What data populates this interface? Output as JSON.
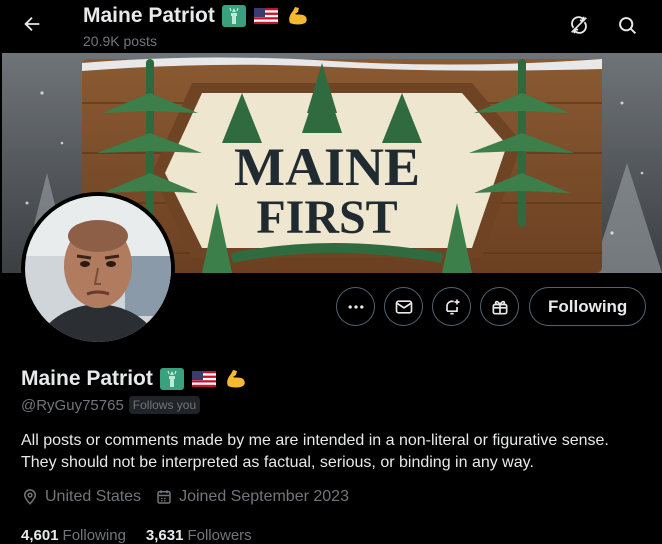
{
  "header": {
    "title": "Maine Patriot",
    "posts": "20.9K posts"
  },
  "banner": {
    "line1": "MAINE",
    "line2": "FIRST"
  },
  "actions": {
    "follow_label": "Following"
  },
  "profile": {
    "name": "Maine Patriot",
    "handle": "@RyGuy75765",
    "follows_you": "Follows you",
    "bio": "All posts or comments made by me are intended in a non-literal or figurative sense. They should not be interpreted as factual, serious, or binding in any way.",
    "location": "United States",
    "joined": "Joined September 2023",
    "following_count": "4,601",
    "following_label": "Following",
    "followers_count": "3,631",
    "followers_label": "Followers"
  },
  "colors": {
    "background": "#000000",
    "text_primary": "#e7e9ea",
    "text_secondary": "#71767b",
    "border": "#536471"
  },
  "icons": [
    "back-arrow-icon",
    "retweet-cycle-icon",
    "search-icon",
    "more-icon",
    "mail-icon",
    "notify-plus-icon",
    "gift-icon",
    "location-pin-icon",
    "calendar-icon",
    "statue-of-liberty-emoji",
    "us-flag-emoji",
    "flexed-biceps-emoji"
  ]
}
